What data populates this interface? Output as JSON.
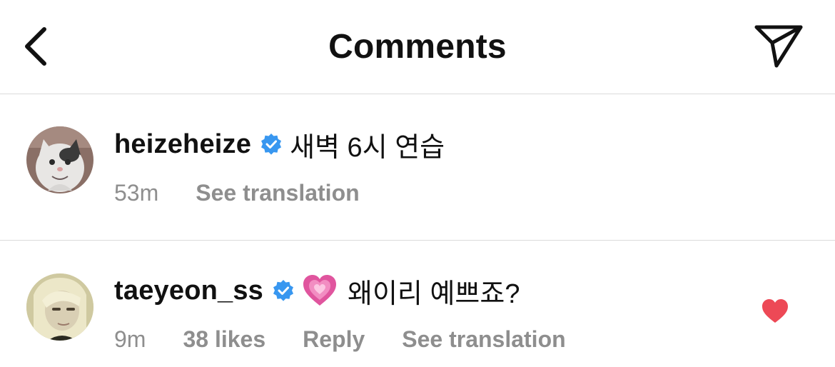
{
  "header": {
    "title": "Comments",
    "back_icon": "chevron-left-icon",
    "share_icon": "paper-plane-icon"
  },
  "comments": [
    {
      "username": "heizeheize",
      "verified": true,
      "text": "새벽 6시 연습",
      "time": "53m",
      "translate_label": "See translation",
      "avatar": "cat-avatar"
    },
    {
      "username": "taeyeon_ss",
      "verified": true,
      "emoji": "growing-heart-emoji",
      "text": "왜이리 예쁘죠?",
      "time": "9m",
      "likes": "38 likes",
      "reply_label": "Reply",
      "translate_label": "See translation",
      "liked": true,
      "avatar": "person-avatar"
    }
  ],
  "colors": {
    "verified_blue": "#3897f0",
    "like_red": "#ed4956",
    "meta_gray": "#8e8e8e",
    "divider": "#dbdbdb"
  }
}
